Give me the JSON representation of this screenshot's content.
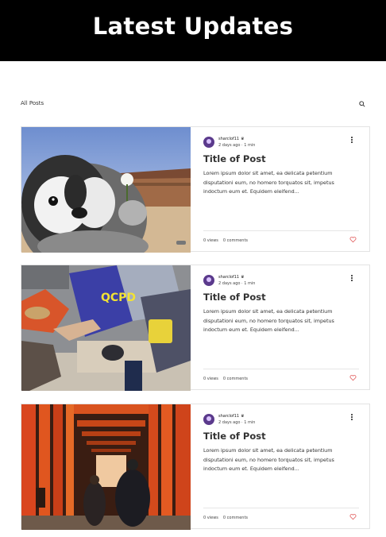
{
  "header": {
    "title": "Latest Updates",
    "background": "#000000"
  },
  "nav": {
    "all_posts": "All Posts",
    "search_icon": "search-icon"
  },
  "posts": [
    {
      "author": "sharclof11",
      "date": "2 days ago",
      "read_time": "1 min",
      "title": "Title of Post",
      "excerpt": "Lorem ipsum dolor sit amet, ea delicata petentium disputationi eum, no homero torquatos sit, impetus indoctum eum et. Equidem eleifend...",
      "views": "0 views",
      "comments": "0 comments",
      "image_caption": "",
      "image_subject": "penguin chick plush"
    },
    {
      "author": "sharclof11",
      "date": "2 days ago",
      "read_time": "1 min",
      "title": "Title of Post",
      "excerpt": "Lorem ipsum dolor sit amet, ea delicata petentium disputationi eum, no homero torquatos sit, impetus indoctum eum et. Equidem eleifend...",
      "views": "0 views",
      "comments": "0 comments",
      "image_caption": "QCPD",
      "image_subject": "riot police shields"
    },
    {
      "author": "sharclof11",
      "date": "2 days ago",
      "read_time": "1 min",
      "title": "Title of Post",
      "excerpt": "Lorem ipsum dolor sit amet, ea delicata petentium disputationi eum, no homero torquatos sit, impetus indoctum eum et. Equidem eleifend...",
      "views": "0 views",
      "comments": "0 comments",
      "image_caption": "",
      "image_subject": "red torii gates"
    }
  ],
  "colors": {
    "heart": "#e05656",
    "text": "#333333",
    "border": "#e3e3e3"
  }
}
